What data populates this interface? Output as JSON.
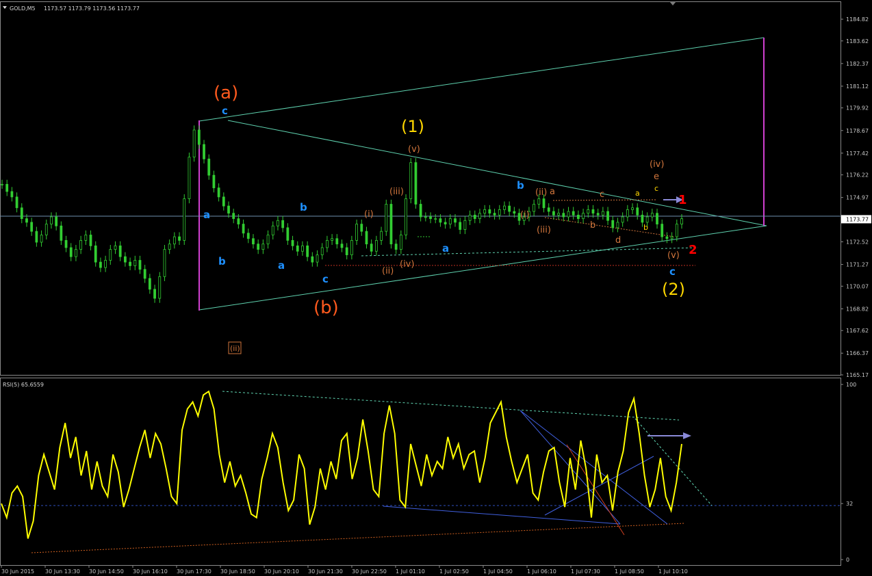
{
  "header": {
    "symbol": "GOLD,M5",
    "ohlc": "1173.57 1173.79 1173.56 1173.77"
  },
  "rsi_header": "RSI(5) 65.6559",
  "colors": {
    "candle": "#32cd32",
    "rsi_line": "#ffff00",
    "channel": "#5fd3b0",
    "magenta": "#d040d0",
    "wave_orange": "#ff5a1e",
    "wave_yellow": "#ffd700",
    "wave_blue": "#1e90ff",
    "wave_tan": "#d2763c",
    "wave_red": "#ff0000",
    "bid_line": "#6f8fb0"
  },
  "chart_data": [
    {
      "type": "line",
      "title": "GOLD,M5",
      "ylim": [
        1165.17,
        1185.2
      ],
      "y_ticks": [
        "1184.82",
        "1183.62",
        "1182.37",
        "1181.12",
        "1179.92",
        "1178.67",
        "1177.42",
        "1176.22",
        "1174.97",
        "1173.77",
        "1172.52",
        "1171.27",
        "1170.07",
        "1168.82",
        "1167.62",
        "1166.37",
        "1165.17"
      ],
      "current_price": "1173.77",
      "close": [
        1175.7,
        1175.3,
        1175.0,
        1174.4,
        1173.8,
        1173.6,
        1173.1,
        1172.5,
        1172.9,
        1173.5,
        1173.9,
        1173.4,
        1172.6,
        1172.2,
        1171.7,
        1172.1,
        1172.6,
        1172.9,
        1172.3,
        1171.4,
        1171.1,
        1171.5,
        1172.1,
        1172.3,
        1171.7,
        1171.4,
        1171.2,
        1171.5,
        1171.0,
        1170.5,
        1169.9,
        1169.4,
        1170.6,
        1172.1,
        1172.4,
        1172.8,
        1172.6,
        1174.9,
        1177.2,
        1178.7,
        1177.9,
        1177.1,
        1176.2,
        1175.5,
        1175.0,
        1174.5,
        1174.1,
        1173.8,
        1173.5,
        1173.0,
        1172.7,
        1172.4,
        1172.1,
        1172.4,
        1172.9,
        1173.4,
        1173.7,
        1173.3,
        1172.6,
        1172.3,
        1172.0,
        1172.3,
        1171.7,
        1171.4,
        1171.8,
        1172.2,
        1172.6,
        1172.7,
        1172.4,
        1172.2,
        1171.8,
        1172.6,
        1173.5,
        1173.1,
        1172.4,
        1172.0,
        1172.6,
        1173.1,
        1174.6,
        1172.4,
        1172.1,
        1172.9,
        1174.9,
        1176.9,
        1174.6,
        1173.9,
        1173.9,
        1173.8,
        1173.8,
        1173.6,
        1173.5,
        1173.8,
        1173.6,
        1173.2,
        1173.7,
        1174.0,
        1173.8,
        1174.1,
        1174.3,
        1174.1,
        1174.0,
        1174.3,
        1174.5,
        1174.2,
        1174.1,
        1173.7,
        1173.9,
        1174.2,
        1174.6,
        1174.9,
        1174.4,
        1174.2,
        1174.0,
        1174.1,
        1173.9,
        1174.2,
        1174.0,
        1173.8,
        1174.1,
        1174.3,
        1174.1,
        1174.0,
        1174.2,
        1173.7,
        1173.3,
        1173.6,
        1173.9,
        1174.3,
        1174.4,
        1174.0,
        1173.6,
        1173.9,
        1174.1,
        1173.5,
        1172.8,
        1172.7,
        1172.8,
        1173.5,
        1173.8
      ]
    },
    {
      "type": "line",
      "title": "RSI(5) 65.6559",
      "ylim": [
        0,
        100
      ],
      "y_ticks": [
        "100",
        "32",
        "0"
      ],
      "reference_level": 32,
      "values": [
        32,
        24,
        38,
        42,
        36,
        12,
        22,
        48,
        60,
        50,
        40,
        64,
        78,
        58,
        70,
        48,
        62,
        40,
        56,
        42,
        36,
        60,
        50,
        30,
        40,
        52,
        64,
        74,
        58,
        72,
        66,
        52,
        36,
        32,
        74,
        86,
        90,
        82,
        94,
        96,
        86,
        60,
        44,
        56,
        42,
        48,
        38,
        26,
        24,
        46,
        58,
        72,
        64,
        44,
        28,
        34,
        60,
        52,
        20,
        30,
        52,
        40,
        56,
        46,
        68,
        72,
        46,
        58,
        80,
        62,
        40,
        36,
        72,
        88,
        72,
        34,
        30,
        66,
        54,
        42,
        60,
        48,
        56,
        52,
        70,
        58,
        66,
        52,
        60,
        62,
        44,
        58,
        78,
        84,
        90,
        70,
        56,
        44,
        52,
        60,
        38,
        34,
        50,
        62,
        64,
        44,
        30,
        58,
        40,
        68,
        52,
        24,
        60,
        44,
        48,
        28,
        50,
        62,
        84,
        92,
        72,
        48,
        30,
        40,
        58,
        36,
        28,
        44,
        66
      ]
    }
  ],
  "x_ticks": [
    "30 Jun 2015",
    "30 Jun 13:30",
    "30 Jun 14:50",
    "30 Jun 16:10",
    "30 Jun 17:30",
    "30 Jun 18:50",
    "30 Jun 20:10",
    "30 Jun 21:30",
    "30 Jun 22:50",
    "1 Jul 01:10",
    "1 Jul 02:50",
    "1 Jul 04:50",
    "1 Jul 06:10",
    "1 Jul 07:30",
    "1 Jul 08:50",
    "1 Jul 10:10"
  ],
  "wave_labels": [
    {
      "text": "(a)",
      "color": "orange",
      "size": "xl"
    },
    {
      "text": "c",
      "color": "blue",
      "size": "m"
    },
    {
      "text": "a",
      "color": "blue",
      "size": "m"
    },
    {
      "text": "b",
      "color": "blue",
      "size": "m"
    },
    {
      "text": "a",
      "color": "blue",
      "size": "m"
    },
    {
      "text": "b",
      "color": "blue",
      "size": "m"
    },
    {
      "text": "c",
      "color": "blue",
      "size": "m"
    },
    {
      "text": "(b)",
      "color": "orange",
      "size": "xl"
    },
    {
      "text": "(1)",
      "color": "yellow",
      "size": "xl"
    },
    {
      "text": "(v)",
      "color": "tan",
      "size": "s"
    },
    {
      "text": "(iii)",
      "color": "tan",
      "size": "s"
    },
    {
      "text": "(i)",
      "color": "tan",
      "size": "s"
    },
    {
      "text": "(ii)",
      "color": "tan",
      "size": "s"
    },
    {
      "text": "(iv)",
      "color": "tan",
      "size": "s"
    },
    {
      "text": "a",
      "color": "blue",
      "size": "m"
    },
    {
      "text": "b",
      "color": "blue",
      "size": "m"
    },
    {
      "text": "(ii)",
      "color": "tan",
      "size": "s"
    },
    {
      "text": "a",
      "color": "tan",
      "size": "s"
    },
    {
      "text": "(i)",
      "color": "tan",
      "size": "s"
    },
    {
      "text": "(iii)",
      "color": "tan",
      "size": "s"
    },
    {
      "text": "c",
      "color": "tan",
      "size": "s"
    },
    {
      "text": "b",
      "color": "tan",
      "size": "s"
    },
    {
      "text": "d",
      "color": "tan",
      "size": "s"
    },
    {
      "text": "(iv)",
      "color": "tan",
      "size": "s"
    },
    {
      "text": "e",
      "color": "tan",
      "size": "s"
    },
    {
      "text": "a",
      "color": "yellow",
      "size": "s"
    },
    {
      "text": "c",
      "color": "yellow",
      "size": "s"
    },
    {
      "text": "b",
      "color": "yellow",
      "size": "s"
    },
    {
      "text": "1",
      "color": "red",
      "size": "l"
    },
    {
      "text": "2",
      "color": "red",
      "size": "l"
    },
    {
      "text": "(v)",
      "color": "tan",
      "size": "s"
    },
    {
      "text": "c",
      "color": "blue",
      "size": "m"
    },
    {
      "text": "(2)",
      "color": "yellow",
      "size": "xl"
    },
    {
      "text": "(ii)",
      "color": "tan",
      "size": "s"
    }
  ]
}
